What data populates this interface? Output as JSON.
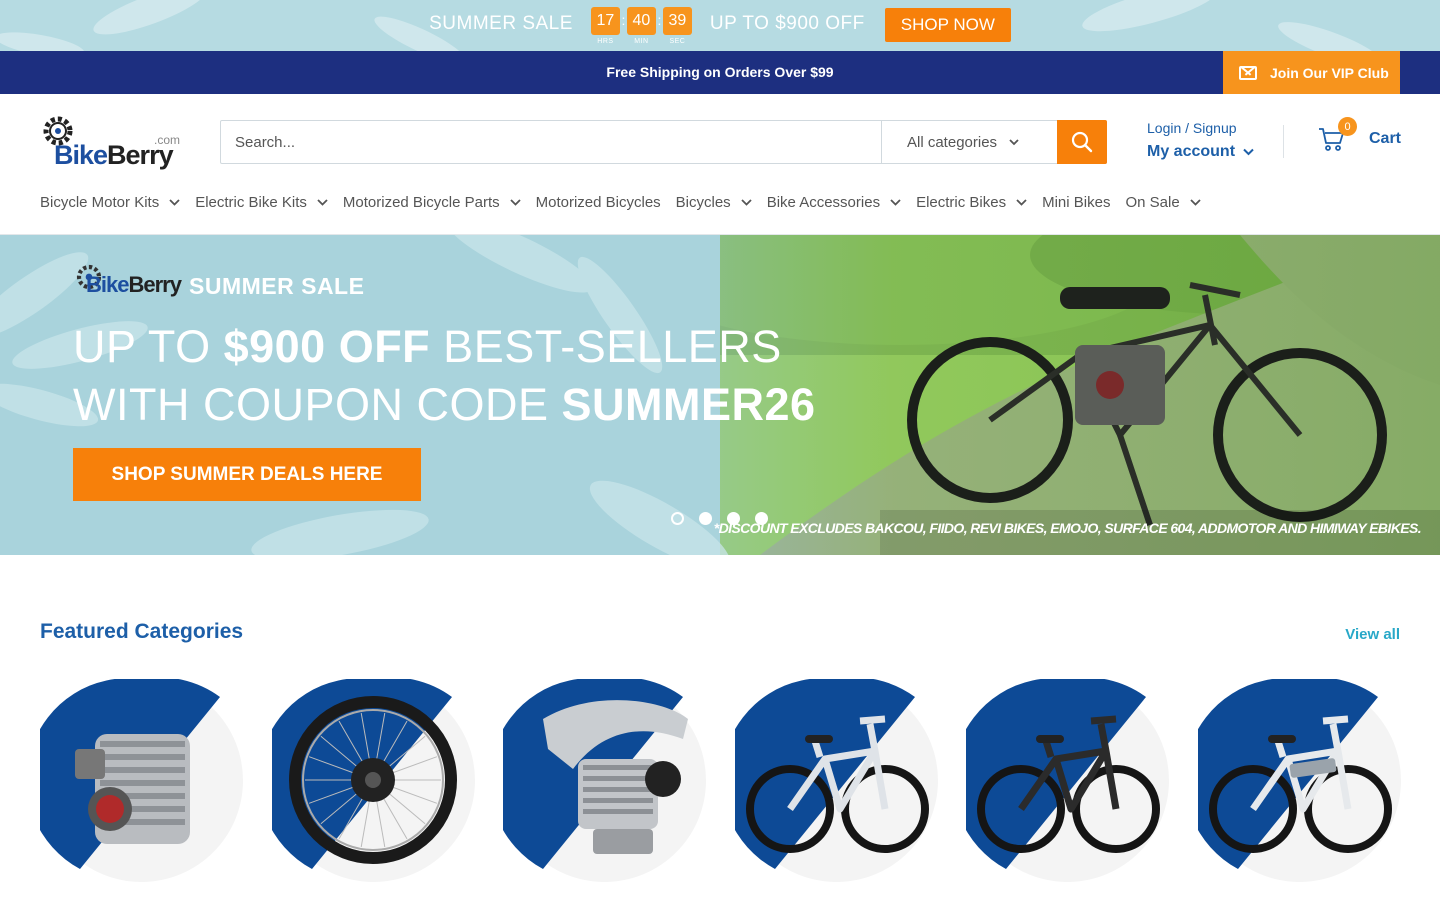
{
  "promo": {
    "title": "SUMMER SALE",
    "countdown": [
      {
        "value": "17",
        "label": "HRS"
      },
      {
        "value": "40",
        "label": "MIN"
      },
      {
        "value": "39",
        "label": "SEC"
      }
    ],
    "offer": "UP TO $900 OFF",
    "button": "SHOP NOW"
  },
  "announcement": {
    "text": "Free Shipping on Orders Over $99",
    "vip": "Join Our VIP Club",
    "vip_icon": "mail-icon"
  },
  "header": {
    "logo_text_blue": "Bike",
    "logo_text_dark": "Berry",
    "logo_suffix": ".com",
    "search_placeholder": "Search...",
    "category_select": "All categories",
    "login": "Login / Signup",
    "my_account": "My account",
    "cart_count": "0",
    "cart_label": "Cart"
  },
  "nav": [
    {
      "label": "Bicycle Motor Kits",
      "dropdown": true
    },
    {
      "label": "Electric Bike Kits",
      "dropdown": true
    },
    {
      "label": "Motorized Bicycle Parts",
      "dropdown": true
    },
    {
      "label": "Motorized Bicycles",
      "dropdown": false
    },
    {
      "label": "Bicycles",
      "dropdown": true
    },
    {
      "label": "Bike Accessories",
      "dropdown": true
    },
    {
      "label": "Electric Bikes",
      "dropdown": true
    },
    {
      "label": "Mini Bikes",
      "dropdown": false
    },
    {
      "label": "On Sale",
      "dropdown": true
    }
  ],
  "hero": {
    "logo_blue": "Bike",
    "logo_dark": "Berry",
    "summer_sale": "SUMMER SALE",
    "line1_pre": "UP TO ",
    "line1_bold": "$900 OFF",
    "line1_post": " BEST-SELLERS",
    "line2_pre": "WITH COUPON CODE ",
    "line2_bold": "SUMMER26",
    "button": "SHOP SUMMER DEALS HERE",
    "disclaimer": "*DISCOUNT EXCLUDES BAKCOU, FIIDO, REVI BIKES, EMOJO, SURFACE 604, ADDMOTOR AND HIMIWAY EBIKES.",
    "slides": 4,
    "active_slide": 1
  },
  "featured": {
    "title": "Featured Categories",
    "view_all": "View all",
    "categories": [
      {
        "icon": "engine-kit-icon"
      },
      {
        "icon": "ebike-wheel-icon"
      },
      {
        "icon": "exhaust-engine-icon"
      },
      {
        "icon": "motorized-bicycle-icon"
      },
      {
        "icon": "cruiser-bicycle-icon"
      },
      {
        "icon": "electric-bike-icon"
      }
    ]
  },
  "colors": {
    "brand_blue": "#1d2f80",
    "accent_orange": "#f7800a",
    "link_blue": "#1d5fa8",
    "circle_blue": "#0d4a96"
  }
}
